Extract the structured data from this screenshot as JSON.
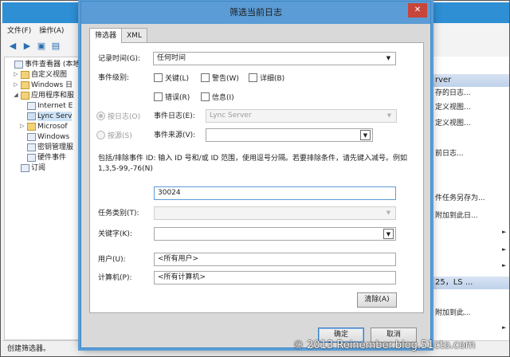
{
  "background_window": {
    "menu": [
      "文件(F)",
      "操作(A)"
    ],
    "tree": [
      {
        "label": "事件查看器 (本地",
        "twisty": "",
        "level": 0
      },
      {
        "label": "自定义视图",
        "twisty": "▷",
        "level": 1
      },
      {
        "label": "Windows 日",
        "twisty": "▷",
        "level": 1
      },
      {
        "label": "应用程序和服",
        "twisty": "◢",
        "level": 1
      },
      {
        "label": "Internet E",
        "twisty": "",
        "level": 2
      },
      {
        "label": "Lync Serv",
        "twisty": "",
        "level": 2
      },
      {
        "label": "Microsof",
        "twisty": "▷",
        "level": 2
      },
      {
        "label": "Windows",
        "twisty": "",
        "level": 2
      },
      {
        "label": "密钥管理服",
        "twisty": "",
        "level": 2
      },
      {
        "label": "硬件事件",
        "twisty": "",
        "level": 2
      },
      {
        "label": "订阅",
        "twisty": "",
        "level": 1
      }
    ],
    "actions": {
      "header1": "rver",
      "items1": [
        "存的日志...",
        "定义视图...",
        "定义视图...",
        "前日志...",
        "",
        "",
        "件任务另存为...",
        "附加到此日...",
        "",
        "",
        ""
      ],
      "header2": "25，LS ...",
      "items2": [
        "",
        "附加到此..."
      ],
      "arrow": "►"
    },
    "status_text": "创建筛选器。"
  },
  "dialog": {
    "title": "筛选当前日志",
    "close": "✕",
    "tabs": [
      "筛选器",
      "XML"
    ],
    "logged_label": "记录时间(G):",
    "logged_value": "任何时间",
    "level_label": "事件级别:",
    "levels": [
      "关键(L)",
      "警告(W)",
      "详细(B)",
      "错误(R)",
      "信息(I)"
    ],
    "by_log_label": "按日志(O)",
    "event_logs_label": "事件日志(E):",
    "event_logs_value": "Lync Server",
    "by_source_label": "按源(S)",
    "event_sources_label": "事件来源(V):",
    "event_sources_value": "",
    "ids_note": "包括/排除事件 ID: 输入 ID 号和/或 ID 范围，使用逗号分隔。若要排除条件，请先键入减号。例如 1,3,5-99,-76(N)",
    "ids_value": "30024",
    "task_category_label": "任务类别(T):",
    "task_category_value": "",
    "keywords_label": "关键字(K):",
    "keywords_value": "",
    "user_label": "用户(U):",
    "user_value": "<所有用户>",
    "computer_label": "计算机(P):",
    "computer_value": "<所有计算机>",
    "clear_button": "清除(A)",
    "ok_button": "确定",
    "cancel_button": "取消"
  },
  "watermark": "© 2013 Reinember.blog.51cto.com",
  "colors": {
    "accent": "#5b9cd6",
    "close": "#c7463c"
  }
}
